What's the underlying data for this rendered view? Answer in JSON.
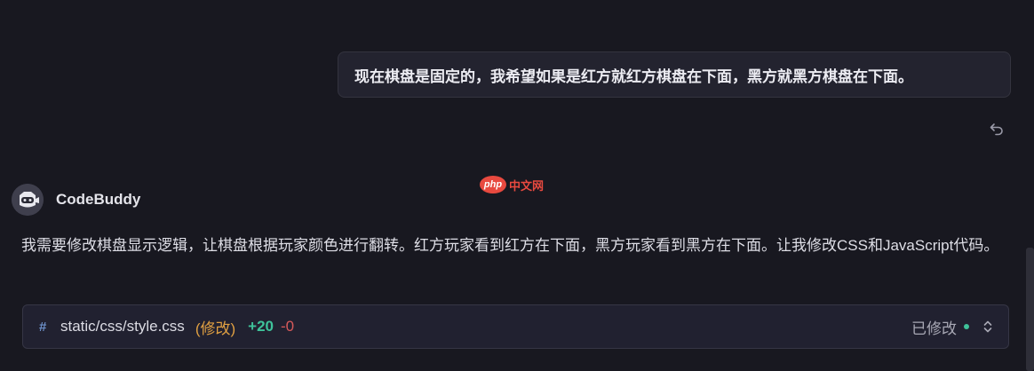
{
  "user_message": {
    "text": "现在棋盘是固定的，我希望如果是红方就红方棋盘在下面，黑方就黑方棋盘在下面。"
  },
  "watermark": {
    "logo_text": "php",
    "text": "中文网"
  },
  "assistant": {
    "name": "CodeBuddy",
    "message": "我需要修改棋盘显示逻辑，让棋盘根据玩家颜色进行翻转。红方玩家看到红方在下面，黑方玩家看到黑方在下面。让我修改CSS和JavaScript代码。"
  },
  "file_change": {
    "icon": "#",
    "path": "static/css/style.css",
    "status": "(修改)",
    "added": "+20",
    "removed": "-0",
    "state_label": "已修改"
  },
  "colors": {
    "background": "#181820",
    "bubble": "#23232f",
    "added": "#3fc29a",
    "removed": "#d85a5a",
    "status": "#e0a042"
  },
  "icons": [
    "undo-icon",
    "bot-avatar-icon",
    "hash-icon",
    "status-dot-icon",
    "chevron-up-down-icon"
  ]
}
